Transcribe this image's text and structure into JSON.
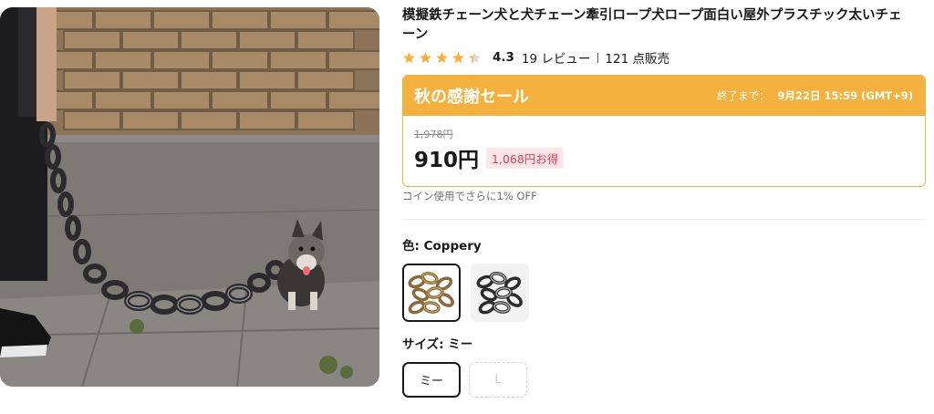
{
  "product": {
    "title": "模擬鉄チェーン犬と犬チェーン牽引ロープ犬ロープ面白い屋外プラスチック太いチェーン",
    "rating": "4.3",
    "stars_filled": 4,
    "stars_partial": 0.3,
    "reviews": "19 レビュー",
    "sold": "121 点販売"
  },
  "sale": {
    "name": "秋の感謝セール",
    "ends_label": "終了まで：",
    "ends_time": "9月22日 15:59 (GMT+9)",
    "original_price": "1,978円",
    "price": "910円",
    "discount": "1,068円お得",
    "coin_note": "コイン使用でさらに1% OFF"
  },
  "options": {
    "color_label": "色: ",
    "color_value": "Coppery",
    "size_label": "サイズ: ",
    "size_value": "ミー",
    "sizes": [
      "ミー",
      "L"
    ]
  },
  "colors": {
    "accent": "#f5b13d",
    "discount_text": "#ee3d55",
    "discount_bg": "#ffe6e9",
    "star": "#f5b13d"
  }
}
